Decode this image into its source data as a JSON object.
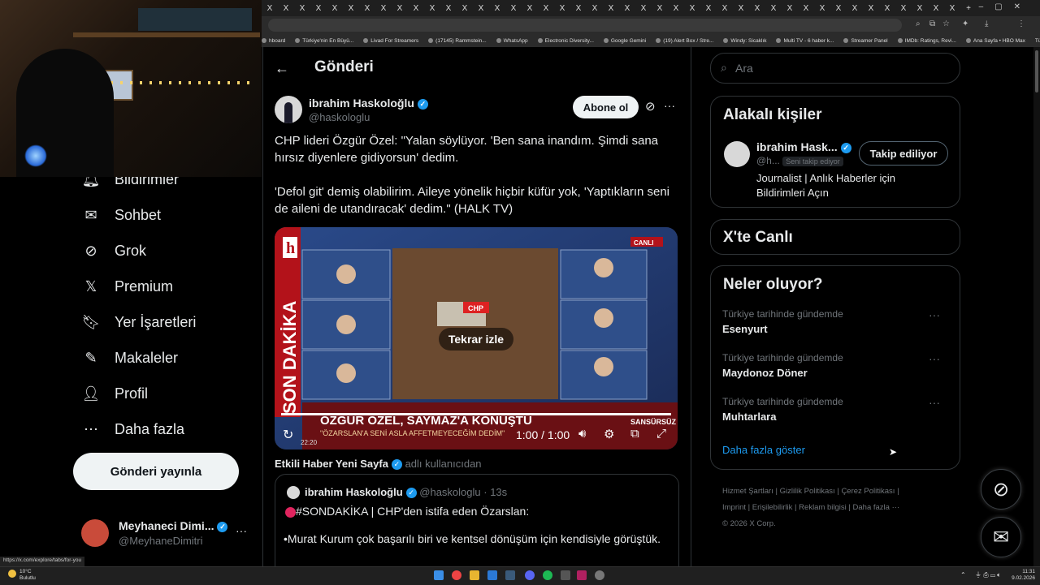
{
  "browser": {
    "tab_close_glyph": "X",
    "bookmarks": [
      "hboard",
      "Türkiye'nin En Büyü...",
      "Livad For Streamers",
      "(17145) Rammstein...",
      "WhatsApp",
      "Electronic Diversity...",
      "Google Gemini",
      "(19) Alert Box / Stre...",
      "Windy: Sicaklık",
      "Multi TV - 6 haber k...",
      "Streamer Panel",
      "IMDb: Ratings, Revi...",
      "Ana Sayfa • HBO Max"
    ],
    "all_bookmarks": "Tüm Yer İşaretleri",
    "status_url": "https://x.com/explore/tabs/for-you"
  },
  "nav": {
    "items": [
      {
        "label": "Bildirimler",
        "icon": "bell-icon"
      },
      {
        "label": "Sohbet",
        "icon": "mail-icon"
      },
      {
        "label": "Grok",
        "icon": "grok-icon"
      },
      {
        "label": "Premium",
        "icon": "x-logo-icon"
      },
      {
        "label": "Yer İşaretleri",
        "icon": "bookmark-icon"
      },
      {
        "label": "Makaleler",
        "icon": "article-icon"
      },
      {
        "label": "Profil",
        "icon": "person-icon"
      },
      {
        "label": "Daha fazla",
        "icon": "more-circle-icon"
      }
    ],
    "post_button": "Gönderi yayınla",
    "account": {
      "name": "Meyhaneci Dimi...",
      "handle": "@MeyhaneDimitri",
      "more": "···"
    }
  },
  "main": {
    "back": "←",
    "title": "Gönderi",
    "author": {
      "name": "ibrahim Haskoloğlu",
      "handle": "@haskologlu"
    },
    "follow_button": "Abone ol",
    "more": "···",
    "text_p1": "CHP lideri Özgür Özel:  \"Yalan söylüyor. 'Ben sana inandım. Şimdi sana hırsız diyenlere gidiyorsun' dedim.",
    "text_p2": "'Defol git' demiş olabilirim. Aileye yönelik hiçbir küfür yok, 'Yaptıkların seni de aileni de utandıracak' dedim.\"  (HALK TV)",
    "video": {
      "replay": "Tekrar izle",
      "time": "1:00 / 1:00",
      "live_badge": "CANLI",
      "ticker_side": "SON DAKİKA",
      "ticker_headline": "ÖZGÜR ÖZEL, SAYMAZ'A KONUŞTU",
      "ticker_sub": "\"ÖZARSLAN'A SENİ ASLA AFFETMEYECEĞİM DEDİM\"",
      "ticker_tag": "SANSÜRSÜZ",
      "clock": "22:20",
      "progress": 1.0,
      "channel_logo": "h",
      "party_logo": "CHP"
    },
    "reply_context": {
      "name": "Etkili Haber Yeni Sayfa",
      "suffix": "adlı kullanıcıdan"
    },
    "quoted": {
      "name": "ibrahim Haskoloğlu",
      "handle": "@haskologlu",
      "time": "· 13s",
      "line1": "#SONDAKİKA | CHP'den istifa eden Özarslan:",
      "line2": "•Murat Kurum çok başarılı biri ve kentsel dönüşüm için kendisiyle görüştük."
    }
  },
  "sidebar": {
    "search_placeholder": "Ara",
    "related": {
      "title": "Alakalı kişiler",
      "name": "ibrahim Hask...",
      "handle": "@h...",
      "follows_you": "Seni takip ediyor",
      "button": "Takip ediliyor",
      "bio": "Journalist | Anlık Haberler için Bildirimleri Açın"
    },
    "live": {
      "title": "X'te Canlı"
    },
    "trends": {
      "title": "Neler oluyor?",
      "items": [
        {
          "context": "Türkiye tarihinde gündemde",
          "name": "Esenyurt"
        },
        {
          "context": "Türkiye tarihinde gündemde",
          "name": "Maydonoz Döner"
        },
        {
          "context": "Türkiye tarihinde gündemde",
          "name": "Muhtarlara"
        }
      ],
      "show_more": "Daha fazla göster"
    },
    "footer": {
      "links": [
        "Hizmet Şartları",
        "Gizlilik Politikası",
        "Çerez Politikası",
        "Imprint",
        "Erişilebilirlik",
        "Reklam bilgisi",
        "Daha fazla ···"
      ],
      "copyright": "© 2026 X Corp."
    }
  },
  "taskbar": {
    "weather_temp": "10°C",
    "weather_desc": "Bulutlu",
    "time": "11:31",
    "date": "9.02.2026"
  },
  "colors": {
    "accent": "#1d9bf0",
    "background": "#000000",
    "border": "#2f3336",
    "muted": "#71767b"
  }
}
